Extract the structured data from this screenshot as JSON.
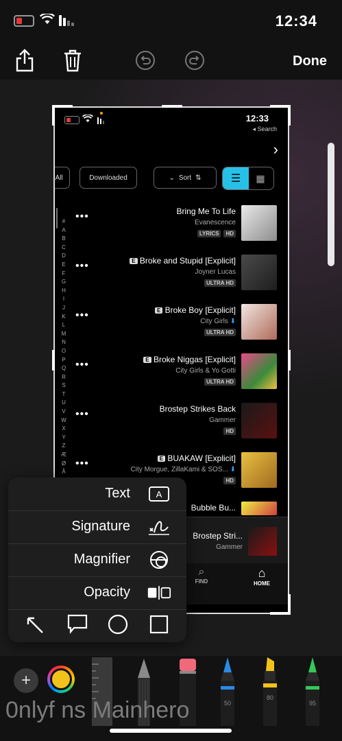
{
  "status_bar": {
    "time": "12:34"
  },
  "toolbar": {
    "done_label": "Done"
  },
  "screenshot": {
    "status_time": "12:33",
    "search_label": "◂ Search",
    "pills": {
      "sort": "Sort",
      "downloaded": "Downloaded",
      "all": "All"
    },
    "alpha_index": [
      "#",
      "A",
      "B",
      "C",
      "D",
      "E",
      "F",
      "G",
      "H",
      "I",
      "J",
      "K",
      "L",
      "M",
      "N",
      "O",
      "P",
      "Q",
      "R",
      "S",
      "T",
      "U",
      "V",
      "W",
      "X",
      "Y",
      "Z",
      "Æ",
      "Ø",
      "Å"
    ],
    "rows": [
      {
        "title": "Bring Me To Life",
        "artist": "Evanescence",
        "badges": [
          "HD",
          "LYRICS"
        ],
        "explicit": false
      },
      {
        "title": "Broke and Stupid [Explicit]",
        "artist": "Joyner Lucas",
        "badges": [
          "ULTRA HD"
        ],
        "explicit": true
      },
      {
        "title": "Broke Boy [Explicit]",
        "artist": "City Girls",
        "badges": [
          "ULTRA HD"
        ],
        "explicit": true
      },
      {
        "title": "Broke Niggas [Explicit]",
        "artist": "City Girls & Yo Gotti",
        "badges": [
          "ULTRA HD"
        ],
        "explicit": true
      },
      {
        "title": "Brostep Strikes Back",
        "artist": "Gammer",
        "badges": [
          "HD"
        ],
        "explicit": false
      },
      {
        "title": "BUAKAW [Explicit]",
        "artist": "City Morgue, ZillaKami & SOS...",
        "badges": [
          "HD"
        ],
        "explicit": true
      },
      {
        "title": "Bubble Bu...",
        "artist": "",
        "badges": [],
        "explicit": false
      }
    ],
    "now_playing": {
      "title": "Brostep Stri...",
      "artist": "Gammer"
    },
    "tabs": {
      "home": "HOME",
      "find": "FIND"
    }
  },
  "popup": {
    "items": [
      {
        "label": "Text",
        "icon": "text-box-icon"
      },
      {
        "label": "Signature",
        "icon": "signature-icon"
      },
      {
        "label": "Magnifier",
        "icon": "magnifier-icon"
      },
      {
        "label": "Opacity",
        "icon": "opacity-icon"
      }
    ]
  },
  "tools": {
    "pen_sizes": {
      "marker_blue": "50",
      "marker_yellow": "80",
      "marker_green": "95"
    },
    "watermark": "0nlyf ns Mainhero"
  },
  "colors": {
    "accent": "#27c1e8",
    "selected_color": "#f2c21a"
  }
}
